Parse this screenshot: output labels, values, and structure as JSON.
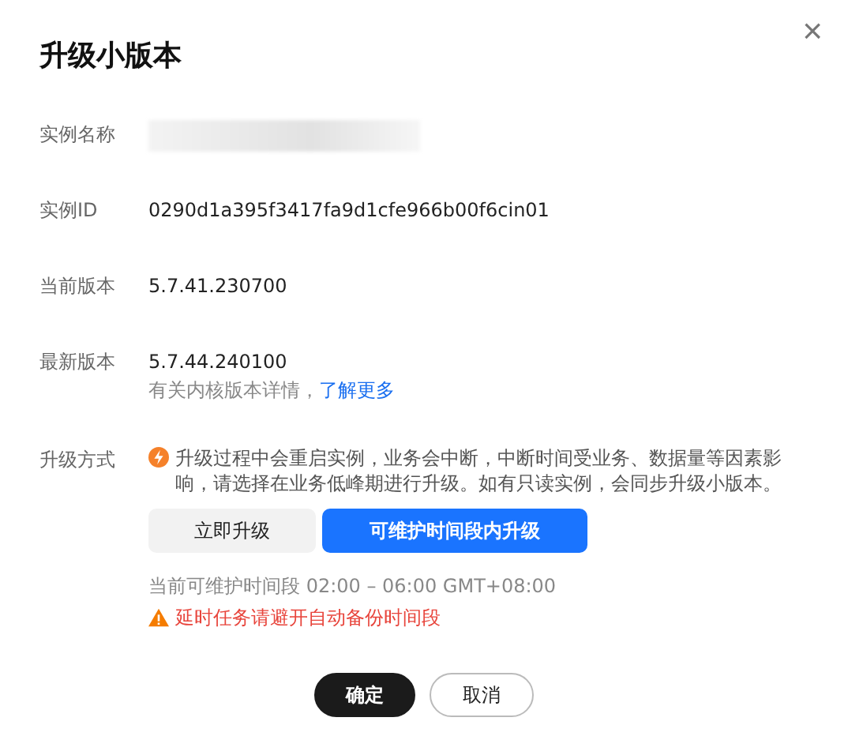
{
  "dialog": {
    "title": "升级小版本",
    "close": "×"
  },
  "fields": [
    {
      "kind": "redacted",
      "label": "实例名称"
    },
    {
      "kind": "text",
      "label": "实例ID",
      "value": "0290d1a395f3417fa9d1cfe966b00f6cin01"
    },
    {
      "kind": "text",
      "label": "当前版本",
      "value": "5.7.41.230700"
    },
    {
      "kind": "text",
      "label": "最新版本",
      "value": "5.7.44.240100",
      "hint": "有关内核版本详情，",
      "link": "了解更多"
    }
  ],
  "upgrade": {
    "label": "升级方式",
    "notice": "升级过程中会重启实例，业务会中断，中断时间受业务、数据量等因素影响，请选择在业务低峰期进行升级。如有只读实例，会同步升级小版本。",
    "options": [
      {
        "label": "立即升级",
        "selected": false
      },
      {
        "label": "可维护时间段内升级",
        "selected": true
      }
    ],
    "window": "当前可维护时间段 02:00 – 06:00 GMT+08:00",
    "warning": "延时任务请避开自动备份时间段"
  },
  "buttons": [
    {
      "kind": "primary",
      "label": "确定"
    },
    {
      "kind": "secondary",
      "label": "取消"
    }
  ]
}
